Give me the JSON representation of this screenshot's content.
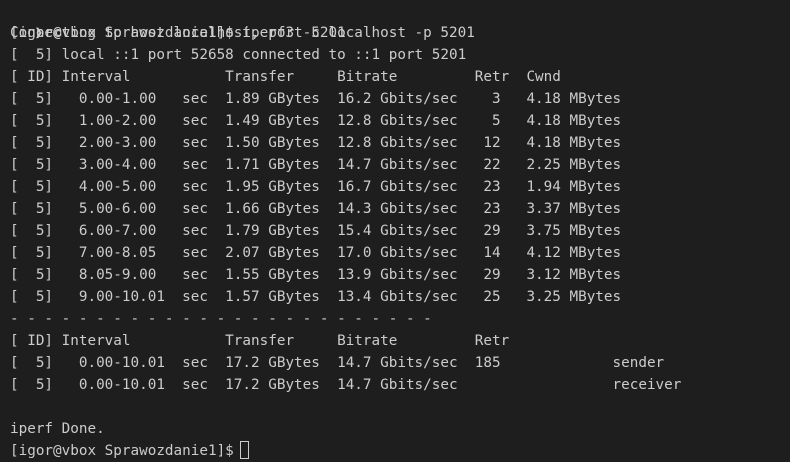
{
  "prompt": {
    "chevron": "❯",
    "first": "[igor@vbox Sprawozdanie1]$ iperf3 -c localhost -p 5201",
    "last": "[igor@vbox Sprawozdanie1]$"
  },
  "output": {
    "connecting": "Connecting to host localhost, port 5201",
    "connected": "[  5] local ::1 port 52658 connected to ::1 port 5201",
    "header": "[ ID] Interval           Transfer     Bitrate         Retr  Cwnd",
    "rows": [
      "[  5]   0.00-1.00   sec  1.89 GBytes  16.2 Gbits/sec    3   4.18 MBytes",
      "[  5]   1.00-2.00   sec  1.49 GBytes  12.8 Gbits/sec    5   4.18 MBytes",
      "[  5]   2.00-3.00   sec  1.50 GBytes  12.8 Gbits/sec   12   4.18 MBytes",
      "[  5]   3.00-4.00   sec  1.71 GBytes  14.7 Gbits/sec   22   2.25 MBytes",
      "[  5]   4.00-5.00   sec  1.95 GBytes  16.7 Gbits/sec   23   1.94 MBytes",
      "[  5]   5.00-6.00   sec  1.66 GBytes  14.3 Gbits/sec   23   3.37 MBytes",
      "[  5]   6.00-7.00   sec  1.79 GBytes  15.4 Gbits/sec   29   3.75 MBytes",
      "[  5]   7.00-8.05   sec  2.07 GBytes  17.0 Gbits/sec   14   4.12 MBytes",
      "[  5]   8.05-9.00   sec  1.55 GBytes  13.9 Gbits/sec   29   3.12 MBytes",
      "[  5]   9.00-10.01  sec  1.57 GBytes  13.4 Gbits/sec   25   3.25 MBytes"
    ],
    "separator": "- - - - - - - - - - - - - - - - - - - - - - - - -",
    "summary_header": "[ ID] Interval           Transfer     Bitrate         Retr",
    "summary_rows": [
      "[  5]   0.00-10.01  sec  17.2 GBytes  14.7 Gbits/sec  185             sender",
      "[  5]   0.00-10.01  sec  17.2 GBytes  14.7 Gbits/sec                  receiver"
    ],
    "done": "iperf Done."
  }
}
